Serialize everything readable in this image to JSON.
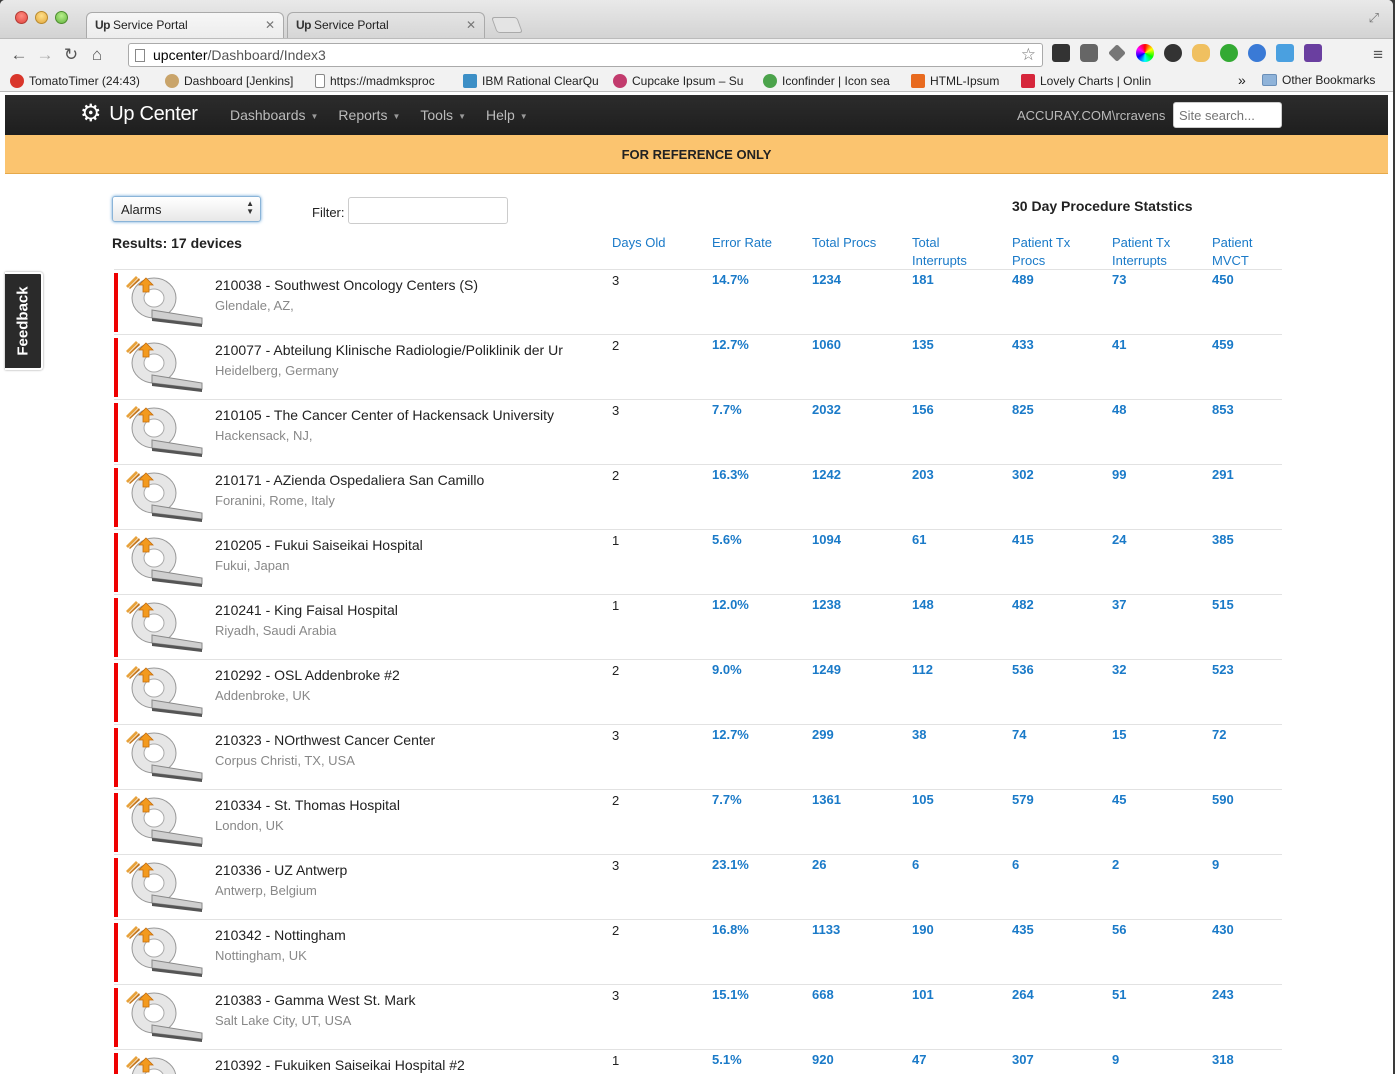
{
  "browser": {
    "tabs": [
      {
        "favicon": "Up",
        "title": "Service Portal"
      },
      {
        "favicon": "Up",
        "title": "Service Portal"
      }
    ],
    "url_host": "upcenter",
    "url_path": "/Dashboard/Index3",
    "bookmarks": [
      {
        "label": "TomatoTimer (24:43)",
        "color": "#d9362b"
      },
      {
        "label": "Dashboard [Jenkins]",
        "color": "#c9a46a"
      },
      {
        "label": "https://madmksproc",
        "color": "#ffffff"
      },
      {
        "label": "IBM Rational ClearQu",
        "color": "#3c8fc6"
      },
      {
        "label": "Cupcake Ipsum – Su",
        "color": "#c23b6d"
      },
      {
        "label": "Iconfinder | Icon sea",
        "color": "#4ba34b"
      },
      {
        "label": "HTML-Ipsum",
        "color": "#e86a1f"
      },
      {
        "label": "Lovely Charts | Onlin",
        "color": "#d6263b"
      }
    ],
    "bookmarks_more": "»",
    "other_bookmarks": "Other Bookmarks"
  },
  "app": {
    "brand": "Up Center",
    "menu": [
      "Dashboards",
      "Reports",
      "Tools",
      "Help"
    ],
    "user": "ACCURAY.COM\\rcravens",
    "search_placeholder": "Site search...",
    "banner": "FOR REFERENCE ONLY",
    "feedback": "Feedback"
  },
  "controls": {
    "select_value": "Alarms",
    "filter_label": "Filter:",
    "results": "Results: 17 devices",
    "stats_title": "30 Day Procedure Statstics"
  },
  "columns": [
    {
      "line1": "Days Old",
      "line2": ""
    },
    {
      "line1": "Error Rate",
      "line2": ""
    },
    {
      "line1": "Total Procs",
      "line2": ""
    },
    {
      "line1": "Total",
      "line2": "Interrupts"
    },
    {
      "line1": "Patient Tx",
      "line2": "Procs"
    },
    {
      "line1": "Patient Tx",
      "line2": "Interrupts"
    },
    {
      "line1": "Patient",
      "line2": "MVCT"
    }
  ],
  "devices": [
    {
      "title": "210038 - Southwest Oncology Centers (S)",
      "location": "Glendale, AZ,",
      "days": "3",
      "error_rate": "14.7%",
      "total_procs": "1234",
      "total_interrupts": "181",
      "tx_procs": "489",
      "tx_interrupts": "73",
      "mvct": "450"
    },
    {
      "title": "210077 - Abteilung Klinische Radiologie/Poliklinik der Ur",
      "location": "Heidelberg, Germany",
      "days": "2",
      "error_rate": "12.7%",
      "total_procs": "1060",
      "total_interrupts": "135",
      "tx_procs": "433",
      "tx_interrupts": "41",
      "mvct": "459"
    },
    {
      "title": "210105 - The Cancer Center of Hackensack University",
      "location": "Hackensack, NJ,",
      "days": "3",
      "error_rate": "7.7%",
      "total_procs": "2032",
      "total_interrupts": "156",
      "tx_procs": "825",
      "tx_interrupts": "48",
      "mvct": "853"
    },
    {
      "title": "210171 - AZienda Ospedaliera San Camillo",
      "location": "Foranini, Rome, Italy",
      "days": "2",
      "error_rate": "16.3%",
      "total_procs": "1242",
      "total_interrupts": "203",
      "tx_procs": "302",
      "tx_interrupts": "99",
      "mvct": "291"
    },
    {
      "title": "210205 - Fukui Saiseikai Hospital",
      "location": "Fukui, Japan",
      "days": "1",
      "error_rate": "5.6%",
      "total_procs": "1094",
      "total_interrupts": "61",
      "tx_procs": "415",
      "tx_interrupts": "24",
      "mvct": "385"
    },
    {
      "title": "210241 - King Faisal Hospital",
      "location": "Riyadh, Saudi Arabia",
      "days": "1",
      "error_rate": "12.0%",
      "total_procs": "1238",
      "total_interrupts": "148",
      "tx_procs": "482",
      "tx_interrupts": "37",
      "mvct": "515"
    },
    {
      "title": "210292 - OSL Addenbroke #2",
      "location": "Addenbroke, UK",
      "days": "2",
      "error_rate": "9.0%",
      "total_procs": "1249",
      "total_interrupts": "112",
      "tx_procs": "536",
      "tx_interrupts": "32",
      "mvct": "523"
    },
    {
      "title": "210323 - NOrthwest Cancer Center",
      "location": "Corpus Christi, TX, USA",
      "days": "3",
      "error_rate": "12.7%",
      "total_procs": "299",
      "total_interrupts": "38",
      "tx_procs": "74",
      "tx_interrupts": "15",
      "mvct": "72"
    },
    {
      "title": "210334 - St. Thomas Hospital",
      "location": "London, UK",
      "days": "2",
      "error_rate": "7.7%",
      "total_procs": "1361",
      "total_interrupts": "105",
      "tx_procs": "579",
      "tx_interrupts": "45",
      "mvct": "590"
    },
    {
      "title": "210336 - UZ Antwerp",
      "location": "Antwerp, Belgium",
      "days": "3",
      "error_rate": "23.1%",
      "total_procs": "26",
      "total_interrupts": "6",
      "tx_procs": "6",
      "tx_interrupts": "2",
      "mvct": "9"
    },
    {
      "title": "210342 - Nottingham",
      "location": "Nottingham, UK",
      "days": "2",
      "error_rate": "16.8%",
      "total_procs": "1133",
      "total_interrupts": "190",
      "tx_procs": "435",
      "tx_interrupts": "56",
      "mvct": "430"
    },
    {
      "title": "210383 - Gamma West St. Mark",
      "location": "Salt Lake City, UT, USA",
      "days": "3",
      "error_rate": "15.1%",
      "total_procs": "668",
      "total_interrupts": "101",
      "tx_procs": "264",
      "tx_interrupts": "51",
      "mvct": "243"
    },
    {
      "title": "210392 - Fukuiken Saiseikai Hospital #2",
      "location": "",
      "days": "1",
      "error_rate": "5.1%",
      "total_procs": "920",
      "total_interrupts": "47",
      "tx_procs": "307",
      "tx_interrupts": "9",
      "mvct": "318"
    }
  ],
  "colors": {
    "accent": "#1a7ac8",
    "alarm": "#e00000",
    "banner": "#fbc46f",
    "navbar": "#222222"
  }
}
